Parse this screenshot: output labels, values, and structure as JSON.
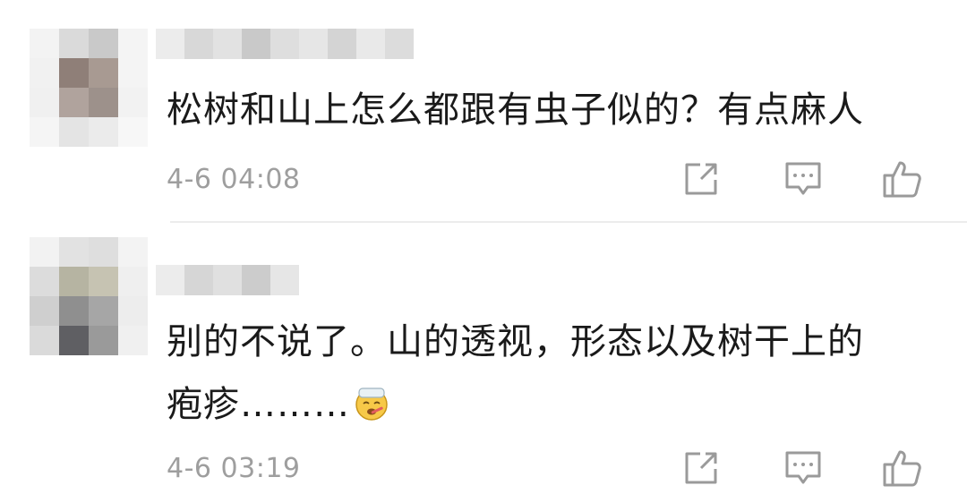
{
  "comments": [
    {
      "avatar_pixels": [
        "#f3f3f3",
        "#dadada",
        "#c9c9c9",
        "#f4f4f4",
        "#f1f1f1",
        "#8f7f78",
        "#a89a92",
        "#f4f4f4",
        "#f0f0f0",
        "#b0a39d",
        "#9d918b",
        "#f2f2f2",
        "#f5f5f5",
        "#e4e4e4",
        "#ebebeb",
        "#f7f7f7"
      ],
      "username_pixels": [
        "#ececec",
        "#d8d8d8",
        "#e2e2e2",
        "#c9c9c9",
        "#dedede",
        "#e6e6e6",
        "#d4d4d4",
        "#e9e9e9",
        "#dcdcdc"
      ],
      "text_lines": [
        "松树和山上怎么都跟有虫子似的？有点麻人"
      ],
      "time": "4-6 04:08",
      "actions": {
        "share_icon": "share-icon",
        "reply_icon": "comment-icon",
        "like_icon": "thumbs-up-icon"
      }
    },
    {
      "avatar_pixels": [
        "#f2f2f2",
        "#e2e2e2",
        "#dedede",
        "#f3f3f3",
        "#dcdcdc",
        "#b6b4a2",
        "#c6c3b2",
        "#efefef",
        "#cfcfcf",
        "#8f8f8f",
        "#a6a6a6",
        "#ededed",
        "#dadada",
        "#5f5f63",
        "#9a9a9a",
        "#f0f0f0"
      ],
      "username_pixels": [
        "#ececec",
        "#d6d6d6",
        "#e0e0e0",
        "#cccccc",
        "#e6e6e6"
      ],
      "text_lines": [
        "别的不说了。山的透视，形态以及树干上的",
        "疱疹………"
      ],
      "emoji": "sick-face-emoji",
      "time": "4-6 03:19",
      "actions": {
        "share_icon": "share-icon",
        "reply_icon": "comment-icon",
        "like_icon": "thumbs-up-icon"
      }
    }
  ],
  "colors": {
    "icon": "#9a9a9a",
    "timestamp": "#9e9e9e",
    "text": "#1a1a1a",
    "divider": "#ececec"
  }
}
